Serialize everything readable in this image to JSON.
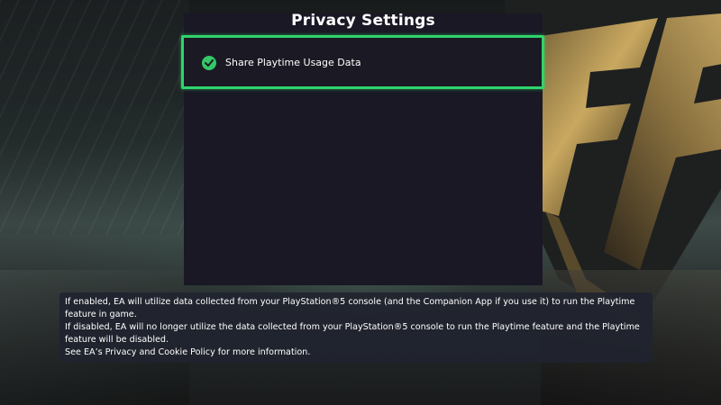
{
  "page": {
    "title": "Privacy Settings"
  },
  "option": {
    "label": "Share Playtime Usage Data",
    "checked": true,
    "icon": "checkmark-circle-icon",
    "accent_color": "#2fd46b"
  },
  "info": {
    "lines": [
      "If enabled, EA will utilize data collected from your PlayStation®5 console (and the Companion App if you use it) to run the Playtime",
      "feature in game.",
      "If disabled, EA will no longer utilize the data collected from your PlayStation®5 console to run the Playtime feature and the Playtime",
      "feature will be disabled.",
      "See EA’s Privacy and Cookie Policy for more information."
    ]
  }
}
